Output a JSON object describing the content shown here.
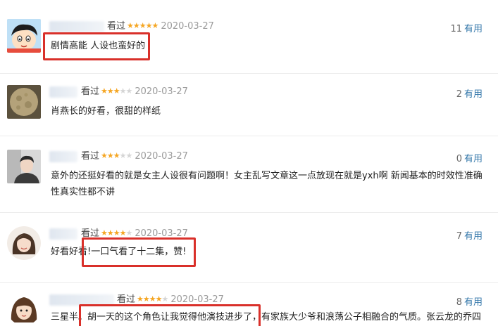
{
  "reviews": [
    {
      "status": "看过",
      "stars": 5,
      "date": "2020-03-27",
      "useful_count": "11",
      "useful_label": "有用",
      "text": "剧情高能 人设也蛮好的",
      "avatar_icon": "cartoon-boy-avatar"
    },
    {
      "status": "看过",
      "stars": 3,
      "date": "2020-03-27",
      "useful_count": "2",
      "useful_label": "有用",
      "text": "肖燕长的好看，很甜的样纸",
      "avatar_icon": "moon-photo-avatar"
    },
    {
      "status": "看过",
      "stars": 3,
      "date": "2020-03-27",
      "useful_count": "0",
      "useful_label": "有用",
      "text_line1": "意外的还挺好看的就是女主人设很有问题啊！女主乱写文章这一点放现在就是yxh啊 新闻基本的时效性准确",
      "text_line2": "性真实性都不讲",
      "avatar_icon": "man-photo-avatar"
    },
    {
      "status": "看过",
      "stars": 4,
      "date": "2020-03-27",
      "useful_count": "7",
      "useful_label": "有用",
      "text": "好看好看!一口气看了十二集，赞!",
      "avatar_icon": "woman-photo-avatar"
    },
    {
      "status": "看过",
      "stars": 4,
      "date": "2020-03-27",
      "useful_count": "8",
      "useful_label": "有用",
      "text": "三星半。胡一天的这个角色让我觉得他演技进步了，有家族大少爷和浪荡公子相融合的气质。张云龙的乔四",
      "avatar_icon": "cartoon-girl-avatar"
    }
  ],
  "colors": {
    "star": "#f5a623",
    "star_empty": "#d5d5d5",
    "highlight_box": "#d9302a",
    "useful_link": "#3377aa"
  }
}
